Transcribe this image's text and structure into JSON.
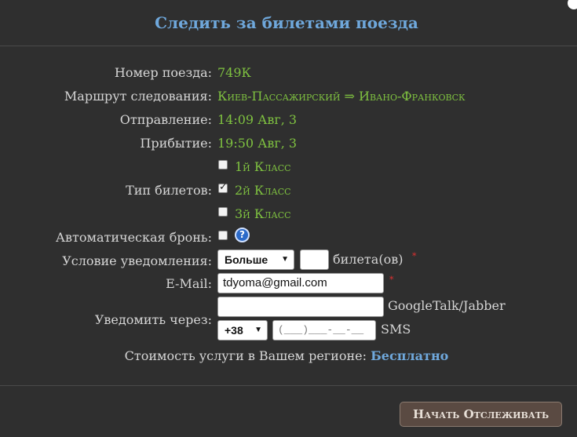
{
  "dialog": {
    "title": "Следить за билетами поезда"
  },
  "train": {
    "number_label": "Номер поезда:",
    "number_value": "749К",
    "route_label": "Маршрут следования:",
    "route_value": "Киев-Пассажирский ⇒ Ивано-Франковск",
    "departure_label": "Отправление:",
    "departure_value": "14:09 Авг, 3",
    "arrival_label": "Прибытие:",
    "arrival_value": "19:50 Авг, 3"
  },
  "ticket_types": {
    "label": "Тип билетов:",
    "options": [
      {
        "label": "1й Класс",
        "checked": false
      },
      {
        "label": "2й Класс",
        "checked": true
      },
      {
        "label": "3й Класс",
        "checked": false
      }
    ]
  },
  "auto_booking": {
    "label": "Автоматическая бронь:",
    "checked": false,
    "help_icon": "question-icon",
    "help_glyph": "?"
  },
  "notify_condition": {
    "label": "Условие уведомления:",
    "select_value": "Больше",
    "count_value": "",
    "suffix": "билета(ов)",
    "required_mark": "*"
  },
  "email": {
    "label": "E-Mail:",
    "value": "tdyoma@gmail.com",
    "required_mark": "*"
  },
  "notify_via": {
    "label": "Уведомить через:",
    "jabber_value": "",
    "jabber_suffix": "GoogleTalk/Jabber",
    "phone_code": "+38",
    "phone_placeholder": "(___)___-__-__",
    "sms_suffix": "SMS"
  },
  "cost": {
    "label": "Стоимость услуги в Вашем регионе:",
    "value": "Бесплатно"
  },
  "actions": {
    "start_label": "Начать Отслеживать"
  },
  "colors": {
    "background": "#2f2f2f",
    "title": "#6fa8dc",
    "value_green": "#7fc240",
    "required_red": "#e03030",
    "button_bg": "#5a4a42"
  }
}
